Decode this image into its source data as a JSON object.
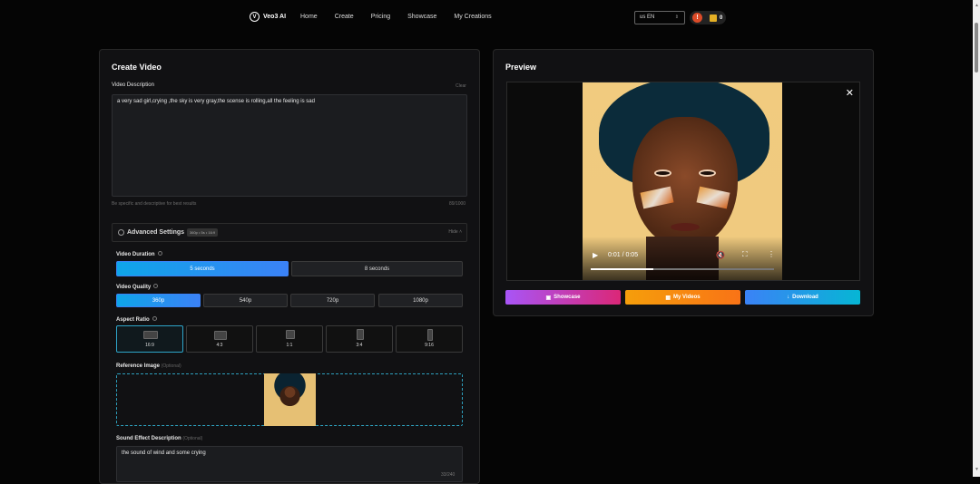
{
  "nav": {
    "brand": "Veo3 AI",
    "brand_icon": "V",
    "links": [
      "Home",
      "Create",
      "Pricing",
      "Showcase",
      "My Creations"
    ],
    "language": "us  EN",
    "credits": "0"
  },
  "create": {
    "title": "Create Video",
    "description_label": "Video Description",
    "clear": "Clear",
    "description": "a very sad girl,crying ,the sky is very gray,the scense is rolling,all the feeling is sad",
    "hint": "Be specific and descriptive for best results",
    "count": "89/1000"
  },
  "advanced": {
    "title": "Advanced Settings",
    "summary": "360p • 5s • 16:9",
    "hide": "Hide"
  },
  "duration": {
    "label": "Video Duration",
    "options": [
      "5 seconds",
      "8 seconds"
    ],
    "selected": "5 seconds"
  },
  "quality": {
    "label": "Video Quality",
    "options": [
      "360p",
      "540p",
      "720p",
      "1080p"
    ],
    "selected": "360p"
  },
  "aspect": {
    "label": "Aspect Ratio",
    "options": [
      "16:9",
      "4:3",
      "1:1",
      "3:4",
      "9:16"
    ],
    "selected": "16:9"
  },
  "reference": {
    "label": "Reference Image",
    "optional": "(Optional)"
  },
  "sound": {
    "label": "Sound Effect Description",
    "optional": "(Optional)",
    "value": "the sound of wind and some crying",
    "count": "33/240"
  },
  "preview": {
    "title": "Preview",
    "close": "✕",
    "time": "0:01 / 0:05",
    "progress": 0.34
  },
  "actions": {
    "showcase": "Showcase",
    "my_videos": "My Videos",
    "download": "Download"
  },
  "colors": {
    "accent": "#0ea5e9",
    "showcase": "#c026d3",
    "my_videos": "#f97316",
    "download": "#3b82f6"
  }
}
